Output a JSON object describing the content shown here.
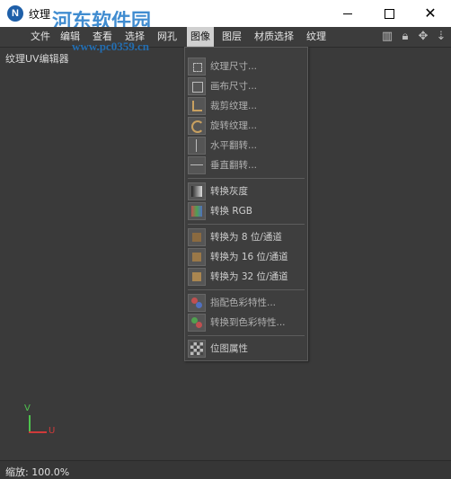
{
  "window": {
    "title": "纹理",
    "watermark": "河东软件园",
    "watermark_url": "www.pc0359.cn"
  },
  "menubar": {
    "items": [
      "文件",
      "编辑",
      "查看",
      "选择",
      "网孔",
      "图像",
      "图层",
      "材质选择",
      "纹理"
    ],
    "active_index": 5
  },
  "toolbar": {
    "icons": [
      "histogram-icon",
      "lock-icon",
      "move-icon",
      "pin-icon"
    ]
  },
  "panel": {
    "label": "纹理UV编辑器"
  },
  "image_menu": {
    "groups": [
      [
        "纹理尺寸...",
        "画布尺寸...",
        "裁剪纹理...",
        "旋转纹理...",
        "水平翻转...",
        "垂直翻转..."
      ],
      [
        "转换灰度",
        "转换 RGB"
      ],
      [
        "转换为 8 位/通道",
        "转换为 16 位/通道",
        "转换为 32 位/通道"
      ],
      [
        "指配色彩特性...",
        "转换到色彩特性..."
      ],
      [
        "位图属性"
      ]
    ]
  },
  "axes": {
    "v": "V",
    "u": "U"
  },
  "status": {
    "zoom": "缩放: 100.0%"
  },
  "colors": {
    "accent": "#1e5fa8",
    "menu_active": "#d0d0d0",
    "axis_v": "#4ec24e",
    "axis_u": "#d03a3a"
  }
}
